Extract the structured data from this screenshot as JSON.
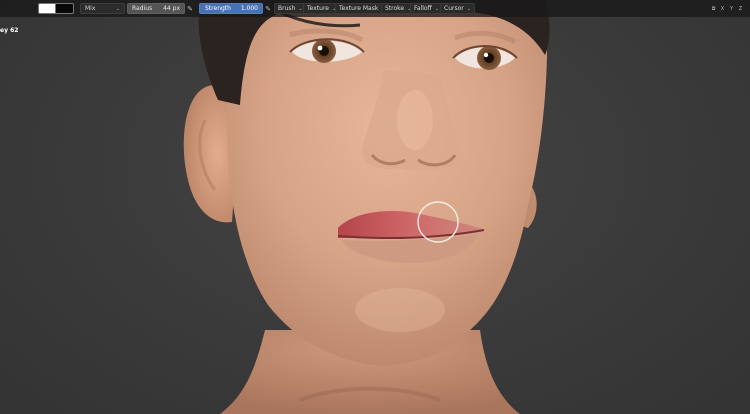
{
  "header": {
    "blend_mode": "Mix",
    "radius": {
      "label": "Radius",
      "value": "44 px"
    },
    "strength": {
      "label": "Strength",
      "value": "1.000",
      "fraction": 1.0
    },
    "menus": [
      "Brush",
      "Texture",
      "Texture Mask",
      "Stroke",
      "Falloff",
      "Cursor"
    ],
    "axis_labels": [
      "X",
      "Y",
      "Z"
    ]
  },
  "status_text": "ey 62",
  "colors": {
    "accent": "#4772b3",
    "primary_color": "#ffffff",
    "secondary_color": "#080808",
    "skin": "#d9a588",
    "lip": "#c25a5a",
    "hair": "#2a2320"
  },
  "icons": [
    "pen-pressure-icon",
    "symmetry-icon",
    "chevron-down-icon",
    "brush-cursor-icon"
  ]
}
